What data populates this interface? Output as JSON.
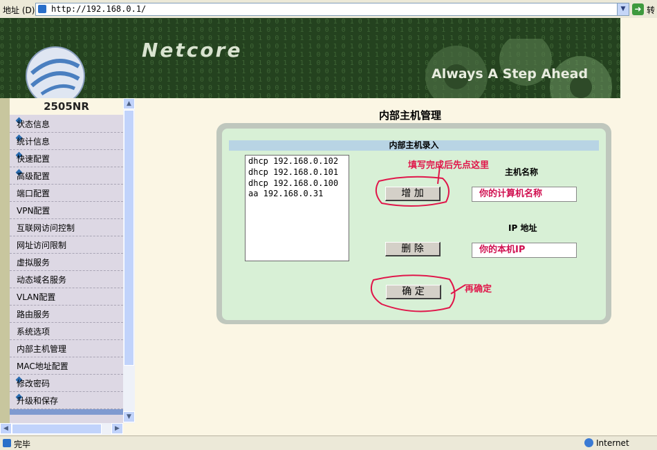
{
  "addressbar": {
    "label": "地址 (D)",
    "url": "http://192.168.0.1/",
    "go_label": "转"
  },
  "banner": {
    "brand": "Netcore",
    "slogan": "Always A Step Ahead",
    "digits": "0 1 0 0 1 1 0 1 0 1 0 0 1 0 1 1 0 1 0 0 1 1 0 1 0 0 1 0 1 1 0 1 0 0 1 0 1 1 0 0 1 0 1 0 1 1 0 0 1 0 1 0 0 1 1 0 1 0 1 0 0 1 0 1 1 0 0 1 0 1 1 0 1 0 0 1 0 1 0 1 1 0"
  },
  "sidebar": {
    "model": "2505NR",
    "items": [
      {
        "label": "状态信息",
        "main": true
      },
      {
        "label": "统计信息",
        "main": true
      },
      {
        "label": "快速配置",
        "main": true
      },
      {
        "label": "高级配置",
        "main": true
      },
      {
        "label": "端口配置",
        "main": false
      },
      {
        "label": "VPN配置",
        "main": false
      },
      {
        "label": "互联网访问控制",
        "main": false
      },
      {
        "label": "网址访问限制",
        "main": false
      },
      {
        "label": "虚拟服务",
        "main": false
      },
      {
        "label": "动态域名服务",
        "main": false
      },
      {
        "label": "VLAN配置",
        "main": false
      },
      {
        "label": "路由服务",
        "main": false
      },
      {
        "label": "系统选项",
        "main": false
      },
      {
        "label": "内部主机管理",
        "main": false
      },
      {
        "label": "MAC地址配置",
        "main": false
      },
      {
        "label": "修改密码",
        "main": true
      },
      {
        "label": "升级和保存",
        "main": true
      }
    ]
  },
  "main": {
    "title": "内部主机管理",
    "section": "内部主机录入",
    "hosts": [
      "dhcp 192.168.0.102",
      "dhcp 192.168.0.101",
      "dhcp 192.168.0.100",
      "aa 192.168.0.31"
    ],
    "add_label": "增 加",
    "delete_label": "删 除",
    "confirm_label": "确 定",
    "hostname_label": "主机名称",
    "hostname_value": "你的计算机名称",
    "ip_label": "IP 地址",
    "ip_value": "你的本机IP"
  },
  "annotations": {
    "first": "填写完成后先点这里",
    "second": "再确定",
    "color": "#e0164a"
  },
  "statusbar": {
    "text": "完毕",
    "zone": "Internet"
  }
}
